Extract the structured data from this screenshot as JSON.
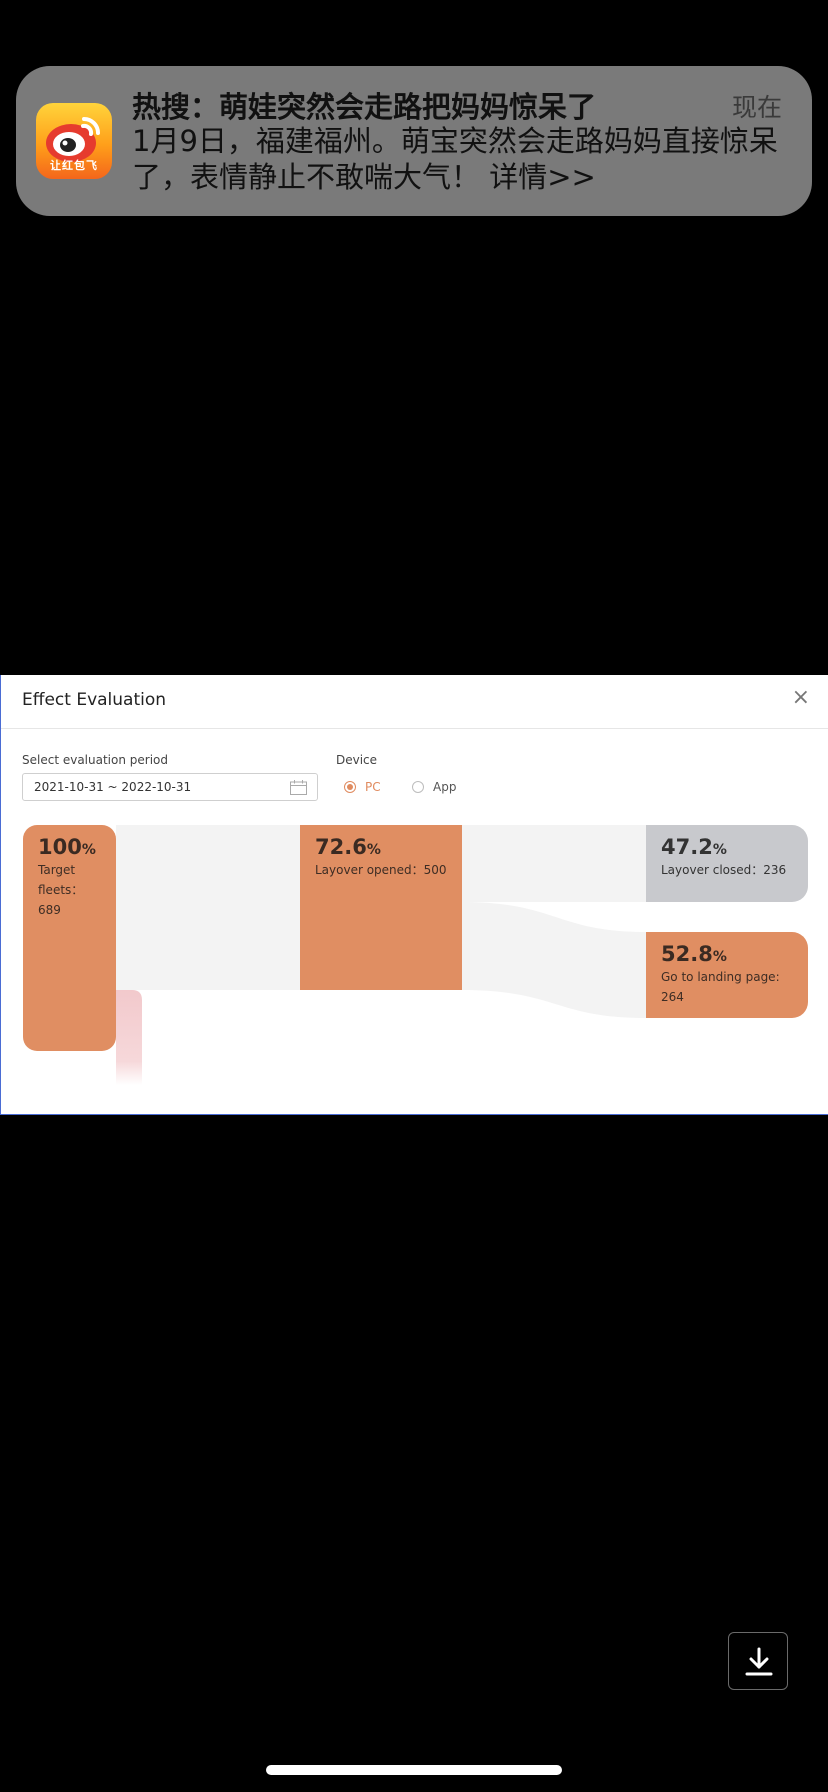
{
  "notification": {
    "app_icon_label": "让红包飞",
    "title": "热搜：萌娃突然会走路把妈妈惊呆了",
    "time": "现在",
    "body": "1月9日，福建福州。萌宝突然会走路妈妈直接惊呆了，表情静止不敢喘大气！ 详情>>"
  },
  "modal": {
    "title": "Effect Evaluation",
    "close_label": "×",
    "period_label": "Select evaluation period",
    "period_value": "2021-10-31 ~ 2022-10-31",
    "device_label": "Device",
    "device_options": [
      "PC",
      "App"
    ],
    "device_selected": "PC"
  },
  "funnel": {
    "target": {
      "pct": "100",
      "unit": "%",
      "label_line1": "Target",
      "label_line2": "fleets：",
      "label_line3": "689"
    },
    "opened": {
      "pct": "72.6",
      "unit": "%",
      "label": "Layover opened：500"
    },
    "closed": {
      "pct": "47.2",
      "unit": "%",
      "label": "Layover closed：236"
    },
    "landing": {
      "pct": "52.8",
      "unit": "%",
      "label_line1": "Go to landing page:",
      "label_line2": "264"
    }
  },
  "colors": {
    "accent": "#e08e62",
    "closed": "#c8c9cd",
    "flow": "#f3f3f3",
    "dropoff": "#f2c9cc"
  },
  "icons": {
    "calendar": "calendar-icon",
    "download": "download-icon",
    "close": "close-icon"
  }
}
